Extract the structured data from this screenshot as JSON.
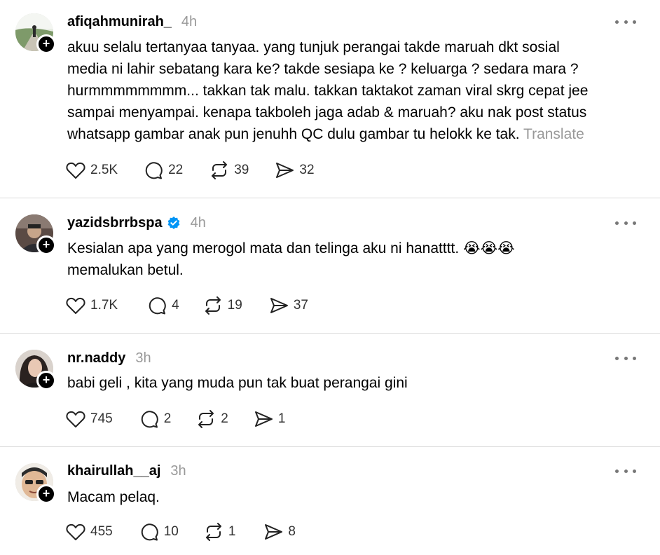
{
  "posts": [
    {
      "username": "afiqahmunirah_",
      "verified": false,
      "time": "4h",
      "text": "akuu selalu tertanyaa tanyaa. yang tunjuk perangai takde maruah dkt sosial\nmedia ni lahir sebatang kara ke? takde sesiapa ke ? keluarga ? sedara mara ?\nhurmmmmmmmm... takkan tak malu. takkan taktakot zaman viral skrg cepat jee\nsampai menyampai. kenapa takboleh jaga adab & maruah? aku nak post status\nwhatsapp gambar anak pun jenuhh QC dulu gambar tu helokk ke tak. ",
      "translate": "Translate",
      "likes": "2.5K",
      "replies": "22",
      "reposts": "39",
      "shares": "32"
    },
    {
      "username": "yazidsbrrbspa",
      "verified": true,
      "time": "4h",
      "text": "Kesialan apa yang merogol mata dan telinga aku ni hanatttt. 😭😭😭\nmemalukan betul.",
      "likes": "1.7K",
      "replies": "4",
      "reposts": "19",
      "shares": "37"
    },
    {
      "username": "nr.naddy",
      "verified": false,
      "time": "3h",
      "text": "babi geli , kita yang muda pun tak buat perangai gini",
      "likes": "745",
      "replies": "2",
      "reposts": "2",
      "shares": "1"
    },
    {
      "username": "khairullah__aj",
      "verified": false,
      "time": "3h",
      "text": "Macam pelaq.",
      "likes": "455",
      "replies": "10",
      "reposts": "1",
      "shares": "8"
    }
  ],
  "icons": {
    "follow": "plus-icon",
    "more": "more-horizontal-icon",
    "like": "heart-icon",
    "reply": "comment-icon",
    "repost": "repost-icon",
    "share": "send-icon",
    "verified": "verified-badge-icon"
  },
  "colors": {
    "muted": "#999999",
    "verified": "#0095f6",
    "divider": "#dbdbdb"
  }
}
